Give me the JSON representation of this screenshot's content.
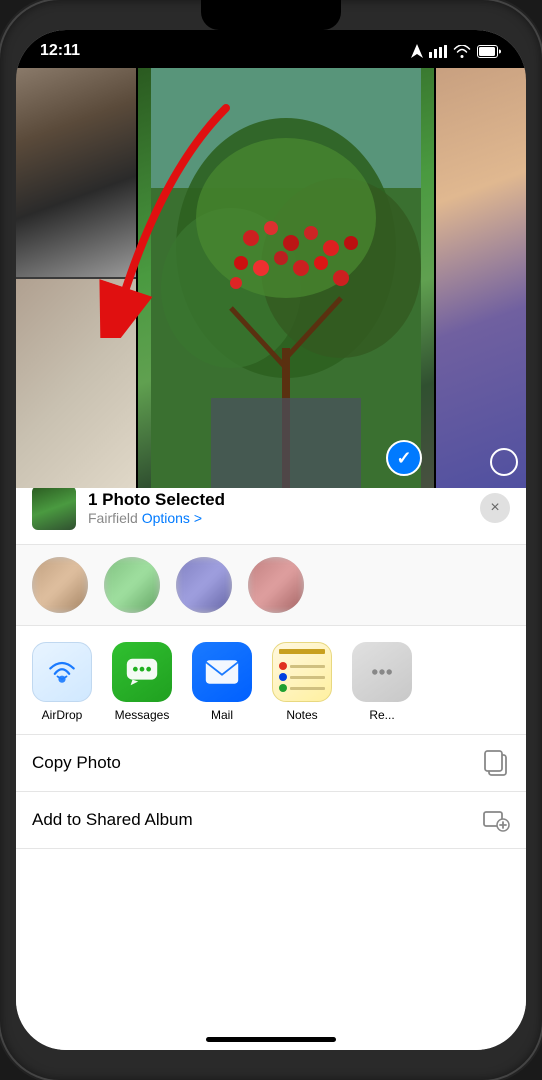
{
  "status_bar": {
    "time": "12:11",
    "location_icon": "location-arrow",
    "signal_icon": "signal-bars",
    "wifi_icon": "wifi",
    "battery_icon": "battery"
  },
  "share_header": {
    "title": "1 Photo Selected",
    "location": "Fairfield",
    "options_link": "Options >",
    "close_label": "×"
  },
  "contacts": [
    {
      "name": "",
      "id": 1
    },
    {
      "name": "",
      "id": 2
    },
    {
      "name": "",
      "id": 3
    },
    {
      "name": "",
      "id": 4
    }
  ],
  "apps": [
    {
      "id": "airdrop",
      "label": "AirDrop"
    },
    {
      "id": "messages",
      "label": "Messages"
    },
    {
      "id": "mail",
      "label": "Mail"
    },
    {
      "id": "notes",
      "label": "Notes"
    },
    {
      "id": "more",
      "label": "Re..."
    }
  ],
  "actions": [
    {
      "id": "copy-photo",
      "label": "Copy Photo",
      "icon": "copy"
    },
    {
      "id": "add-shared-album",
      "label": "Add to Shared Album",
      "icon": "shared-album"
    }
  ]
}
